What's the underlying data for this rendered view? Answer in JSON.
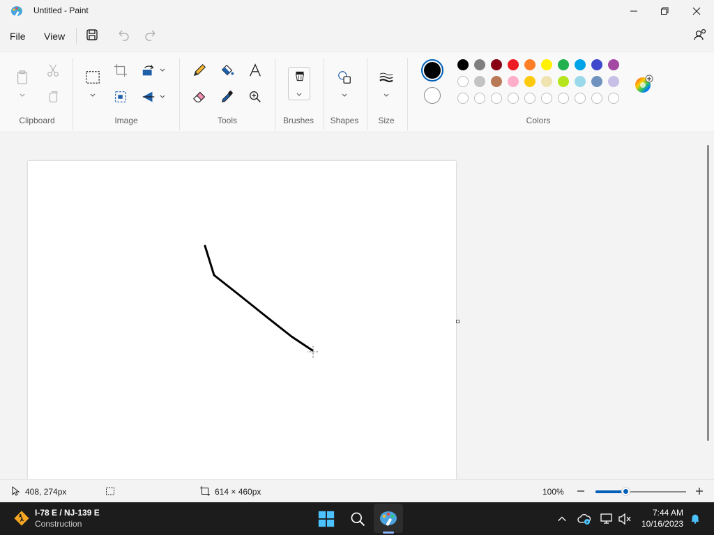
{
  "window": {
    "title": "Untitled - Paint"
  },
  "menu": {
    "file_label": "File",
    "view_label": "View"
  },
  "ribbon": {
    "groups": {
      "clipboard": "Clipboard",
      "image": "Image",
      "tools": "Tools",
      "brushes": "Brushes",
      "shapes": "Shapes",
      "size": "Size",
      "colors": "Colors"
    },
    "primary_color": "#000000",
    "secondary_color": "#ffffff",
    "palette_row1": [
      "#000000",
      "#7f7f7f",
      "#880015",
      "#ed1c24",
      "#ff7f27",
      "#fff200",
      "#22b14c",
      "#00a2e8",
      "#3f48cc",
      "#a349a4"
    ],
    "palette_row2": [
      "#ffffff",
      "#c3c3c3",
      "#b97a57",
      "#ffaec9",
      "#ffc90e",
      "#efe4b0",
      "#b5e61d",
      "#99d9ea",
      "#7092be",
      "#c8bfe7"
    ],
    "palette_row3_custom_slots": 10
  },
  "status": {
    "cursor_position": "408, 274px",
    "canvas_size": "614 × 460px",
    "zoom": "100%",
    "zoom_fraction": 0.34
  },
  "taskbar": {
    "weather_title": "I-78 E / NJ-139 E",
    "weather_subtitle": "Construction",
    "time": "7:44 AM",
    "date": "10/16/2023"
  },
  "colors": {
    "accent": "#005fb8",
    "taskbar_bg": "#1c1c1c"
  }
}
